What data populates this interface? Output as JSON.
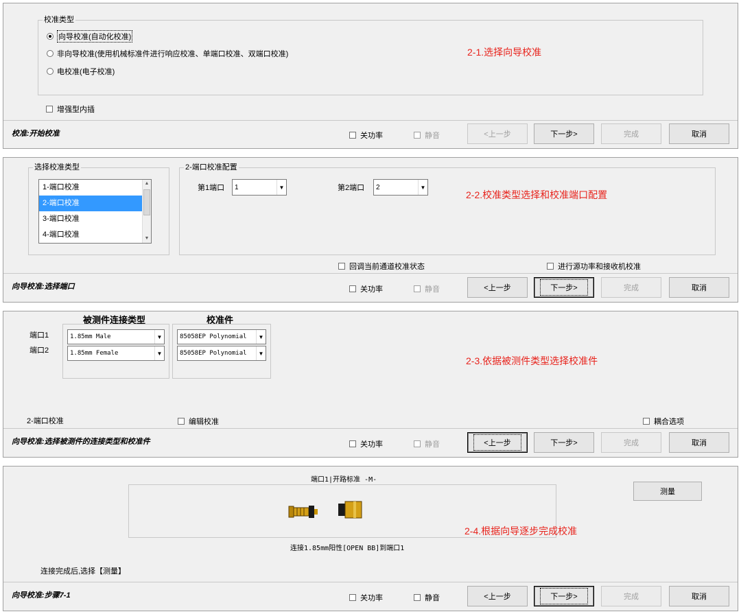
{
  "common": {
    "power_off": "关功率",
    "mute": "静音",
    "prev": "<上一步",
    "next": "下一步>",
    "finish": "完成",
    "cancel": "取消"
  },
  "step1": {
    "group_title": "校准类型",
    "options": [
      "向导校准(自动化校准)",
      "非向导校准(使用机械标准件进行响应校准、单端口校准、双端口校准)",
      "电校准(电子校准)"
    ],
    "selected_index": 0,
    "enhanced_interp": "增强型内插",
    "status": "校准:开始校准",
    "annotation": "2-1.选择向导校准"
  },
  "step2": {
    "type_group_title": "选择校准类型",
    "list_items": [
      "1-端口校准",
      "2-端口校准",
      "3-端口校准",
      "4-端口校准"
    ],
    "selected_index": 1,
    "config_group_title": "2-端口校准配置",
    "port1_label": "第1端口",
    "port1_value": "1",
    "port2_label": "第2端口",
    "port2_value": "2",
    "recall_state": "回调当前通道校准状态",
    "src_power_cal": "进行源功率和接收机校准",
    "status": "向导校准:选择端口",
    "annotation": "2-2.校准类型选择和校准端口配置"
  },
  "step3": {
    "col_conn": "被测件连接类型",
    "col_kit": "校准件",
    "port1_label": "端口1",
    "port2_label": "端口2",
    "port1_conn": "1.85mm Male",
    "port2_conn": "1.85mm Female",
    "port1_kit": "85058EP Polynomial",
    "port2_kit": "85058EP Polynomial",
    "cal_mode": "2-端口校准",
    "edit_cal": "编辑校准",
    "coupling": "耦合选项",
    "status": "向导校准:选择被测件的连接类型和校准件",
    "annotation": "2-3.依据被测件类型选择校准件"
  },
  "step4": {
    "title": "端口1|开路标准 -M-",
    "measure": "测量",
    "connect_text": "连接1.85mm阳性[OPEN BB]到端口1",
    "after_text": "连接完成后,选择【测量】",
    "status": "向导校准:步骤7-1",
    "annotation": "2-4.根据向导逐步完成校准"
  }
}
